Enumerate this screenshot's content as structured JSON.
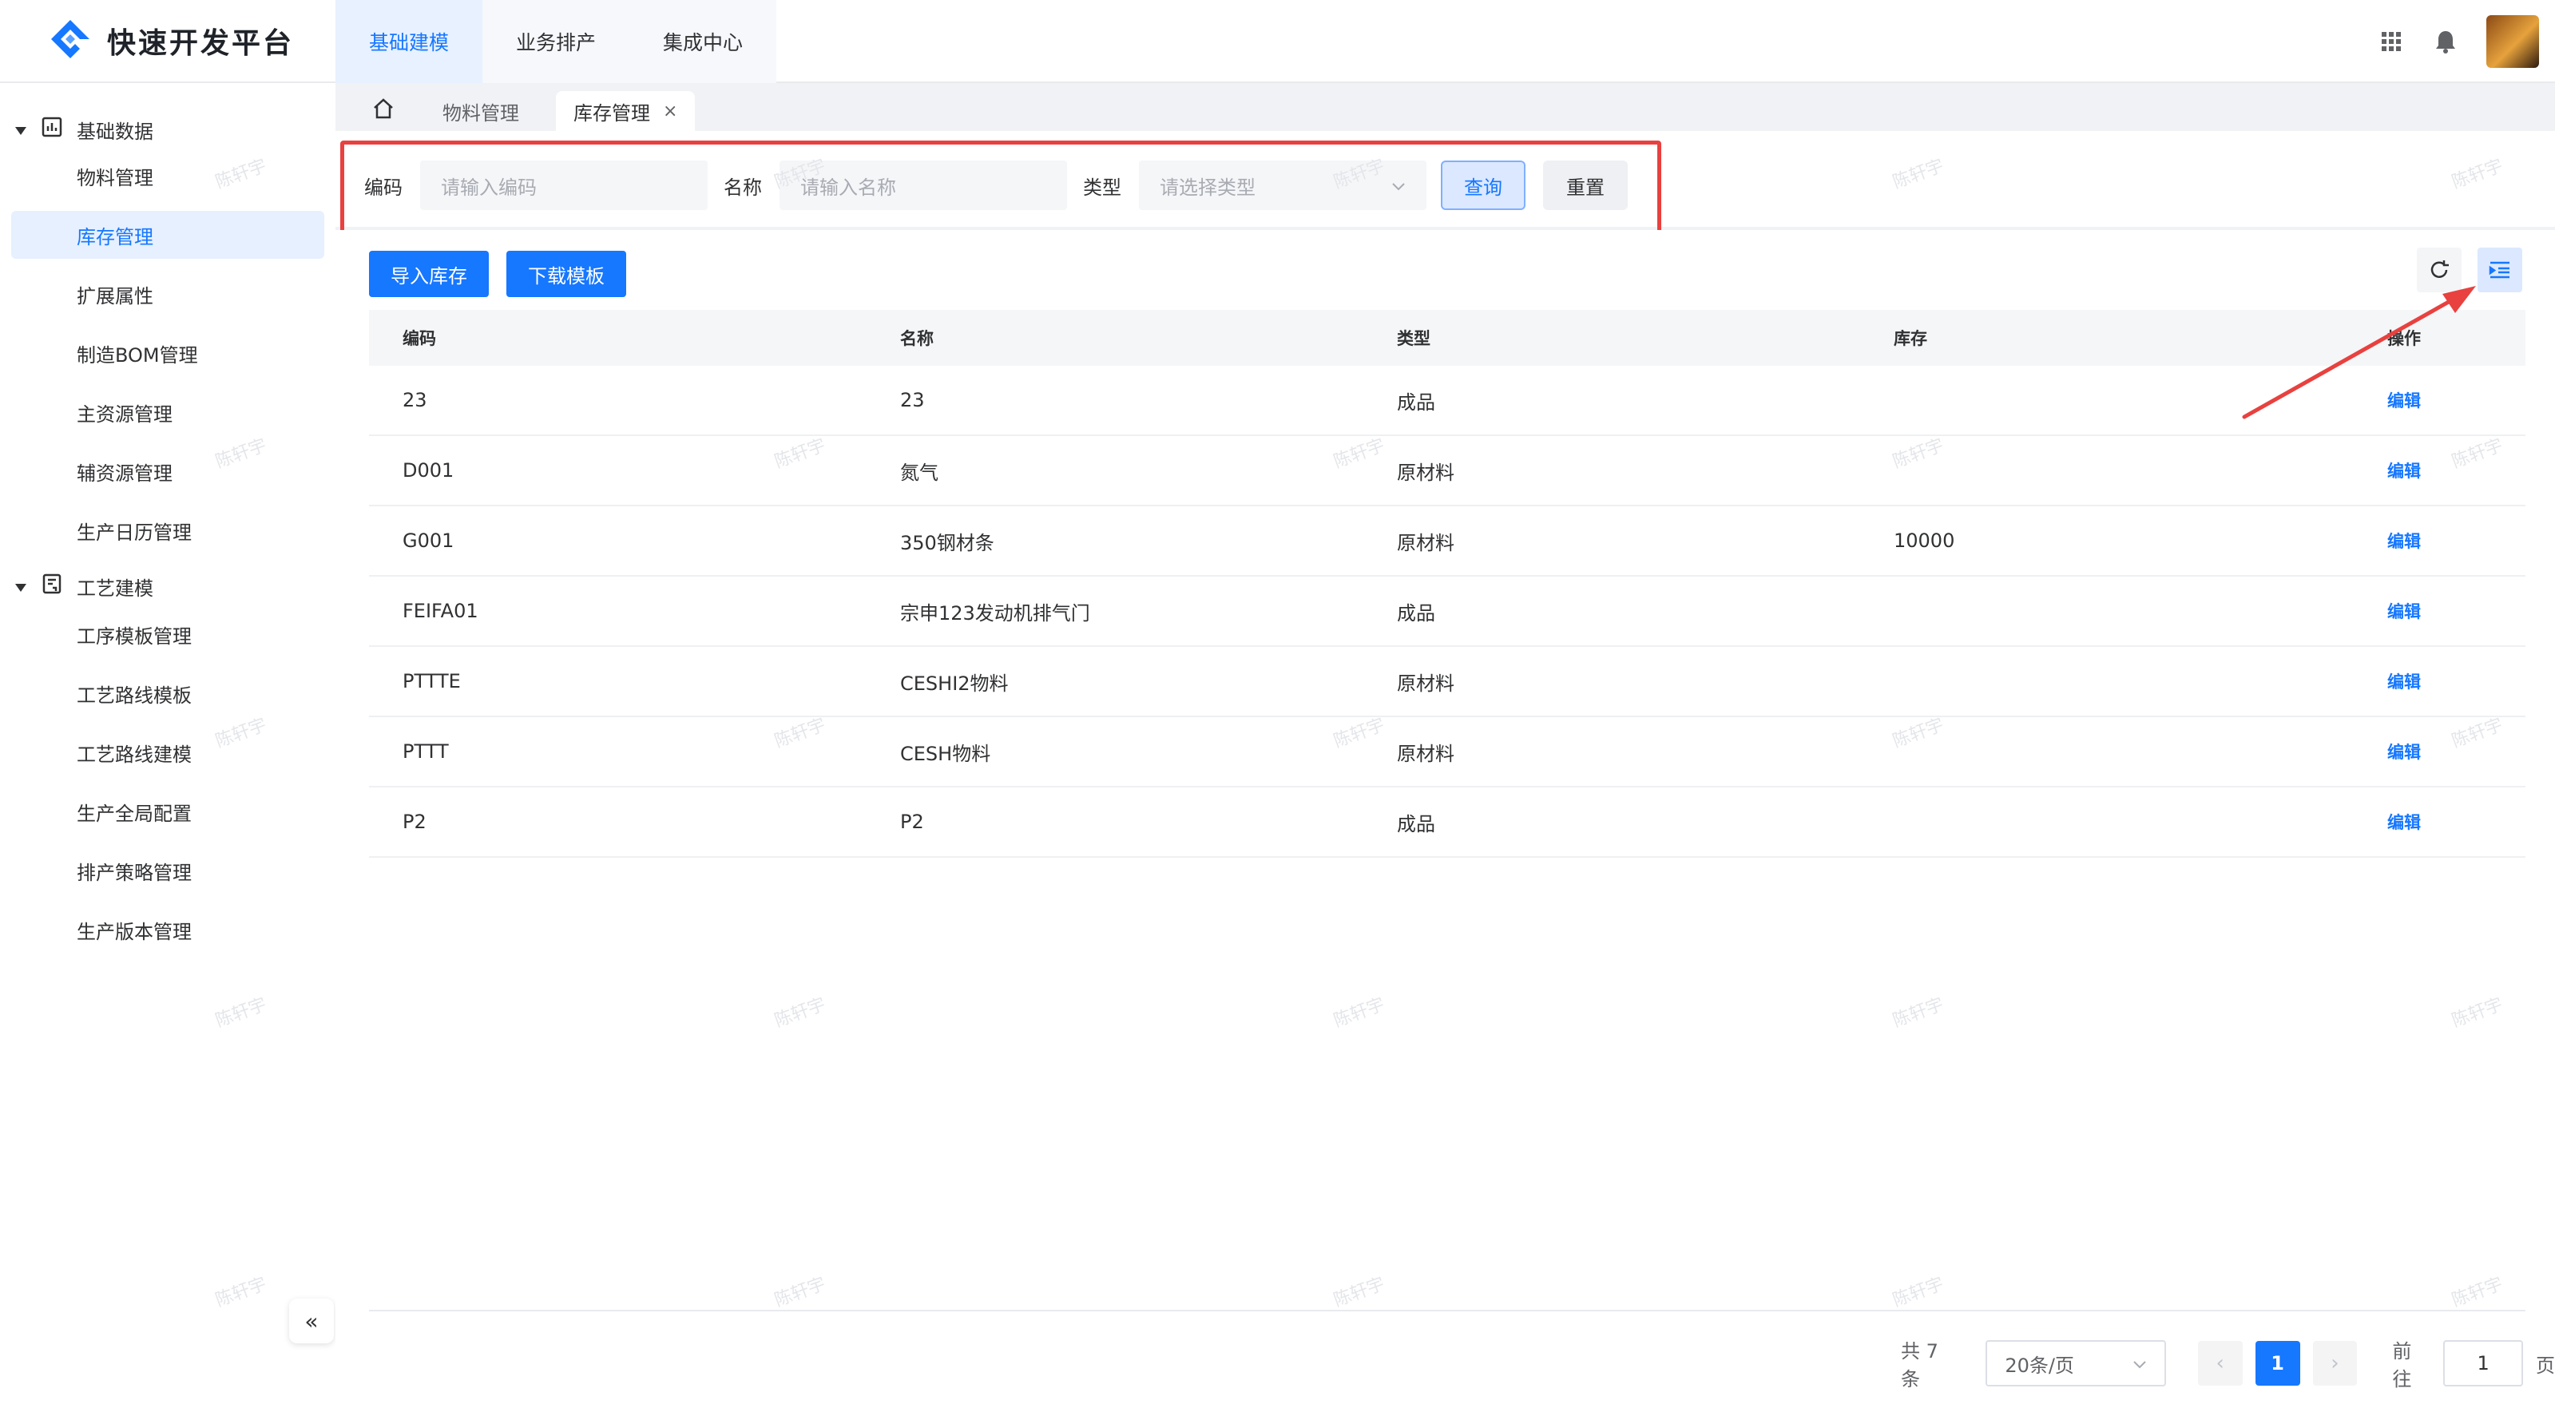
{
  "header": {
    "logo_text": "快速开发平台",
    "nav": [
      {
        "label": "基础建模",
        "active": true
      },
      {
        "label": "业务排产",
        "active": false
      },
      {
        "label": "集成中心",
        "active": false
      }
    ],
    "icons": [
      "apps-grid-icon",
      "bell-icon",
      "avatar"
    ]
  },
  "sidebar": {
    "groups": [
      {
        "label": "基础数据",
        "icon": "chart-icon",
        "items": [
          "物料管理",
          "库存管理",
          "扩展属性",
          "制造BOM管理",
          "主资源管理",
          "辅资源管理",
          "生产日历管理"
        ]
      },
      {
        "label": "工艺建模",
        "icon": "document-icon",
        "items": [
          "工序模板管理",
          "工艺路线模板",
          "工艺路线建模",
          "生产全局配置",
          "排产策略管理",
          "生产版本管理"
        ]
      }
    ],
    "active_item": "库存管理",
    "collapse_glyph": "«"
  },
  "tabs": {
    "items": [
      {
        "label": "物料管理",
        "active": false
      },
      {
        "label": "库存管理",
        "active": true
      }
    ],
    "close_glyph": "×"
  },
  "search": {
    "code_label": "编码",
    "code_placeholder": "请输入编码",
    "name_label": "名称",
    "name_placeholder": "请输入名称",
    "type_label": "类型",
    "type_placeholder": "请选择类型",
    "query_button": "查询",
    "reset_button": "重置"
  },
  "toolbar": {
    "import_button": "导入库存",
    "download_button": "下载模板"
  },
  "table": {
    "columns": [
      "编码",
      "名称",
      "类型",
      "库存",
      "操作"
    ],
    "rows": [
      {
        "code": "23",
        "name": "23",
        "type": "成品",
        "stock": "",
        "action": "编辑"
      },
      {
        "code": "D001",
        "name": "氮气",
        "type": "原材料",
        "stock": "",
        "action": "编辑"
      },
      {
        "code": "G001",
        "name": "350钢材条",
        "type": "原材料",
        "stock": "10000",
        "action": "编辑"
      },
      {
        "code": "FEIFA01",
        "name": "宗申123发动机排气门",
        "type": "成品",
        "stock": "",
        "action": "编辑"
      },
      {
        "code": "PTTTE",
        "name": "CESHI2物料",
        "type": "原材料",
        "stock": "",
        "action": "编辑"
      },
      {
        "code": "PTTT",
        "name": "CESH物料",
        "type": "原材料",
        "stock": "",
        "action": "编辑"
      },
      {
        "code": "P2",
        "name": "P2",
        "type": "成品",
        "stock": "",
        "action": "编辑"
      }
    ]
  },
  "pagination": {
    "total": "共 7 条",
    "page_size": "20条/页",
    "current": "1",
    "goto_label": "前往",
    "goto_value": "1",
    "page_unit": "页"
  },
  "watermark": "陈轩宇",
  "colors": {
    "primary": "#1677ff",
    "highlight": "#e8413f",
    "sidebar_active_bg": "#e6f0ff"
  }
}
